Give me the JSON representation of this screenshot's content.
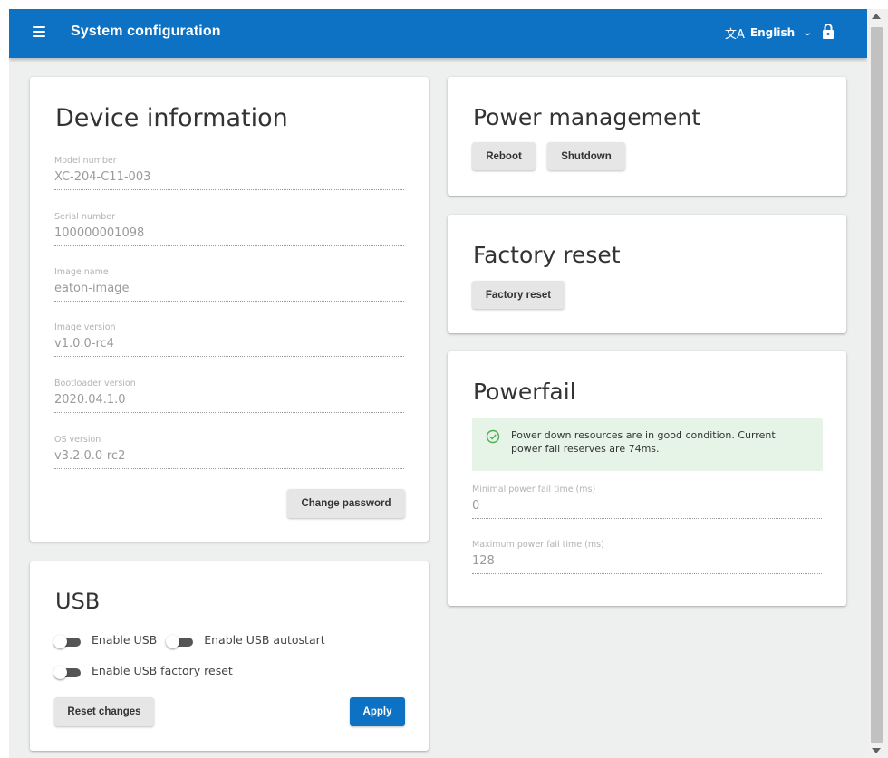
{
  "app": {
    "title": "System configuration",
    "language": "English",
    "accent_color": "#0d71c4"
  },
  "icons": {
    "menu": "hamburger-icon",
    "translate": "translate-icon",
    "lock": "lock-icon",
    "check": "check-circle-icon"
  },
  "device_info": {
    "title": "Device information",
    "fields": [
      {
        "label": "Model number",
        "value": "XC-204-C11-003"
      },
      {
        "label": "Serial number",
        "value": "100000001098"
      },
      {
        "label": "Image name",
        "value": "eaton-image"
      },
      {
        "label": "Image version",
        "value": "v1.0.0-rc4"
      },
      {
        "label": "Bootloader version",
        "value": "2020.04.1.0"
      },
      {
        "label": "OS version",
        "value": "v3.2.0.0-rc2"
      }
    ],
    "change_password_label": "Change password"
  },
  "usb": {
    "title": "USB",
    "toggles": [
      {
        "label": "Enable USB",
        "enabled": false
      },
      {
        "label": "Enable USB autostart",
        "enabled": false
      },
      {
        "label": "Enable USB factory reset",
        "enabled": false
      }
    ],
    "reset_label": "Reset changes",
    "apply_label": "Apply"
  },
  "power_management": {
    "title": "Power management",
    "reboot_label": "Reboot",
    "shutdown_label": "Shutdown"
  },
  "factory_reset": {
    "title": "Factory reset",
    "button_label": "Factory reset"
  },
  "powerfail": {
    "title": "Powerfail",
    "status_message": "Power down resources are in good condition. Current power fail reserves are 74ms.",
    "status_color": "#e6f3e7",
    "fields": [
      {
        "label": "Minimal power fail time (ms)",
        "value": "0"
      },
      {
        "label": "Maximum power fail time (ms)",
        "value": "128"
      }
    ]
  }
}
